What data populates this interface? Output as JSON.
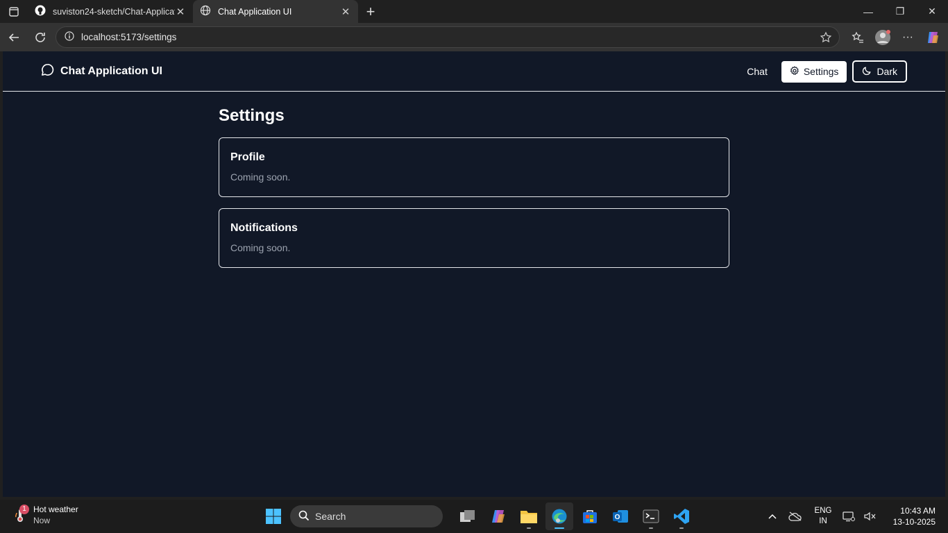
{
  "browser": {
    "tabs": [
      {
        "title": "suviston24-sketch/Chat-Applicatio",
        "icon": "github-icon"
      },
      {
        "title": "Chat Application UI",
        "icon": "globe-icon"
      }
    ],
    "url": "localhost:5173/settings"
  },
  "app": {
    "brand": "Chat Application UI",
    "nav": {
      "chat": "Chat",
      "settings": "Settings",
      "theme": "Dark"
    }
  },
  "settings": {
    "title": "Settings",
    "cards": [
      {
        "title": "Profile",
        "body": "Coming soon."
      },
      {
        "title": "Notifications",
        "body": "Coming soon."
      }
    ]
  },
  "taskbar": {
    "weather_title": "Hot weather",
    "weather_sub": "Now",
    "weather_badge": "1",
    "search": "Search",
    "lang_top": "ENG",
    "lang_bottom": "IN",
    "time": "10:43 AM",
    "date": "13-10-2025"
  },
  "colors": {
    "page_bg": "#111827",
    "text_muted": "#9ca3af",
    "accent": "#4cc2ff"
  }
}
